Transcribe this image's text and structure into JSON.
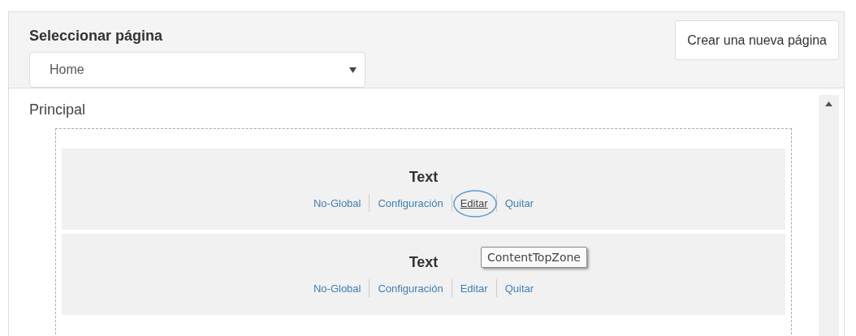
{
  "header": {
    "title": "Seleccionar página",
    "page_select": {
      "value": "Home"
    },
    "create_button": "Crear una nueva página"
  },
  "zone": {
    "title": "Principal",
    "widgets": [
      {
        "title": "Text",
        "actions": [
          {
            "label": "No-Global",
            "highlighted": false
          },
          {
            "label": "Configuración",
            "highlighted": false
          },
          {
            "label": "Editar",
            "highlighted": true
          },
          {
            "label": "Quitar",
            "highlighted": false
          }
        ]
      },
      {
        "title": "Text",
        "actions": [
          {
            "label": "No-Global",
            "highlighted": false
          },
          {
            "label": "Configuración",
            "highlighted": false
          },
          {
            "label": "Editar",
            "highlighted": false
          },
          {
            "label": "Quitar",
            "highlighted": false
          }
        ]
      }
    ]
  },
  "tooltip": "ContentTopZone"
}
